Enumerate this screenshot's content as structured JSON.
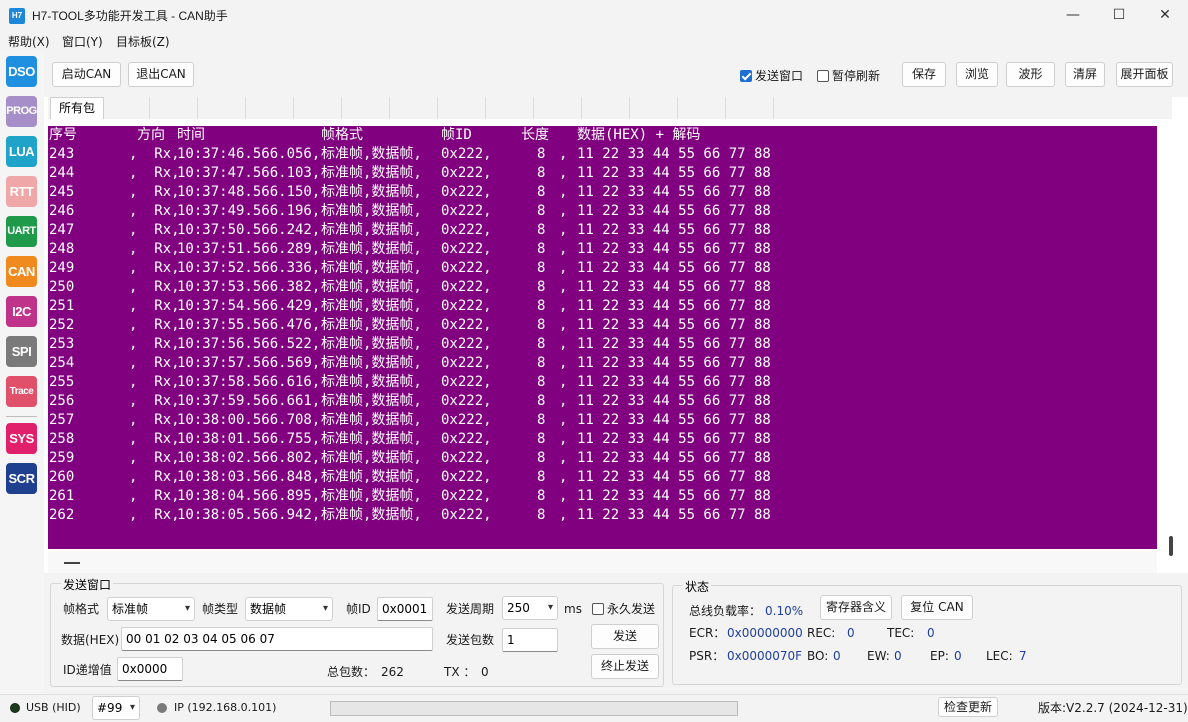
{
  "window": {
    "icon_text": "H7",
    "title": "H7-TOOL多功能开发工具 - CAN助手",
    "minimize": "—",
    "maximize": "☐",
    "close": "✕"
  },
  "menu": [
    "帮助(X)",
    "窗口(Y)",
    "目标板(Z)"
  ],
  "sidebar": [
    {
      "label": "DSO",
      "color": "#1f8fe0"
    },
    {
      "label": "PROG",
      "color": "#a68fc8"
    },
    {
      "label": "LUA",
      "color": "#1fa3c8"
    },
    {
      "label": "RTT",
      "color": "#f0a7a7"
    },
    {
      "label": "UART",
      "color": "#1f9a4a"
    },
    {
      "label": "CAN",
      "color": "#f08a1f"
    },
    {
      "label": "I2C",
      "color": "#c0338a"
    },
    {
      "label": "SPI",
      "color": "#7a7a7a"
    },
    {
      "label": "Trace",
      "color": "#e0506a"
    },
    {
      "label": "SYS",
      "color": "#e0206a"
    },
    {
      "label": "SCR",
      "color": "#1f3f8f"
    }
  ],
  "toolbar": {
    "start_can": "启动CAN",
    "exit_can": "退出CAN",
    "send_window_label": "发送窗口",
    "send_window_checked": true,
    "pause_refresh_label": "暂停刷新",
    "pause_refresh_checked": false,
    "save": "保存",
    "browse": "浏览",
    "waveform": "波形",
    "clear": "清屏",
    "expand_panel": "展开面板"
  },
  "tabs": [
    "所有包"
  ],
  "console": {
    "header": {
      "seq": "序号",
      "dir": "方向",
      "time": "时间",
      "fmt": "帧格式",
      "id": "帧ID",
      "len": "长度",
      "data": "数据(HEX) + 解码"
    },
    "rows": [
      {
        "seq": "243",
        "dir": ",  Rx,",
        "time": "10:37:46.566.056,",
        "fmt": "标准帧,数据帧,",
        "id": "0x222,",
        "len": "8",
        "sep": ",",
        "data": "11 22 33 44 55 66 77 88"
      },
      {
        "seq": "244",
        "dir": ",  Rx,",
        "time": "10:37:47.566.103,",
        "fmt": "标准帧,数据帧,",
        "id": "0x222,",
        "len": "8",
        "sep": ",",
        "data": "11 22 33 44 55 66 77 88"
      },
      {
        "seq": "245",
        "dir": ",  Rx,",
        "time": "10:37:48.566.150,",
        "fmt": "标准帧,数据帧,",
        "id": "0x222,",
        "len": "8",
        "sep": ",",
        "data": "11 22 33 44 55 66 77 88"
      },
      {
        "seq": "246",
        "dir": ",  Rx,",
        "time": "10:37:49.566.196,",
        "fmt": "标准帧,数据帧,",
        "id": "0x222,",
        "len": "8",
        "sep": ",",
        "data": "11 22 33 44 55 66 77 88"
      },
      {
        "seq": "247",
        "dir": ",  Rx,",
        "time": "10:37:50.566.242,",
        "fmt": "标准帧,数据帧,",
        "id": "0x222,",
        "len": "8",
        "sep": ",",
        "data": "11 22 33 44 55 66 77 88"
      },
      {
        "seq": "248",
        "dir": ",  Rx,",
        "time": "10:37:51.566.289,",
        "fmt": "标准帧,数据帧,",
        "id": "0x222,",
        "len": "8",
        "sep": ",",
        "data": "11 22 33 44 55 66 77 88"
      },
      {
        "seq": "249",
        "dir": ",  Rx,",
        "time": "10:37:52.566.336,",
        "fmt": "标准帧,数据帧,",
        "id": "0x222,",
        "len": "8",
        "sep": ",",
        "data": "11 22 33 44 55 66 77 88"
      },
      {
        "seq": "250",
        "dir": ",  Rx,",
        "time": "10:37:53.566.382,",
        "fmt": "标准帧,数据帧,",
        "id": "0x222,",
        "len": "8",
        "sep": ",",
        "data": "11 22 33 44 55 66 77 88"
      },
      {
        "seq": "251",
        "dir": ",  Rx,",
        "time": "10:37:54.566.429,",
        "fmt": "标准帧,数据帧,",
        "id": "0x222,",
        "len": "8",
        "sep": ",",
        "data": "11 22 33 44 55 66 77 88"
      },
      {
        "seq": "252",
        "dir": ",  Rx,",
        "time": "10:37:55.566.476,",
        "fmt": "标准帧,数据帧,",
        "id": "0x222,",
        "len": "8",
        "sep": ",",
        "data": "11 22 33 44 55 66 77 88"
      },
      {
        "seq": "253",
        "dir": ",  Rx,",
        "time": "10:37:56.566.522,",
        "fmt": "标准帧,数据帧,",
        "id": "0x222,",
        "len": "8",
        "sep": ",",
        "data": "11 22 33 44 55 66 77 88"
      },
      {
        "seq": "254",
        "dir": ",  Rx,",
        "time": "10:37:57.566.569,",
        "fmt": "标准帧,数据帧,",
        "id": "0x222,",
        "len": "8",
        "sep": ",",
        "data": "11 22 33 44 55 66 77 88"
      },
      {
        "seq": "255",
        "dir": ",  Rx,",
        "time": "10:37:58.566.616,",
        "fmt": "标准帧,数据帧,",
        "id": "0x222,",
        "len": "8",
        "sep": ",",
        "data": "11 22 33 44 55 66 77 88"
      },
      {
        "seq": "256",
        "dir": ",  Rx,",
        "time": "10:37:59.566.661,",
        "fmt": "标准帧,数据帧,",
        "id": "0x222,",
        "len": "8",
        "sep": ",",
        "data": "11 22 33 44 55 66 77 88"
      },
      {
        "seq": "257",
        "dir": ",  Rx,",
        "time": "10:38:00.566.708,",
        "fmt": "标准帧,数据帧,",
        "id": "0x222,",
        "len": "8",
        "sep": ",",
        "data": "11 22 33 44 55 66 77 88"
      },
      {
        "seq": "258",
        "dir": ",  Rx,",
        "time": "10:38:01.566.755,",
        "fmt": "标准帧,数据帧,",
        "id": "0x222,",
        "len": "8",
        "sep": ",",
        "data": "11 22 33 44 55 66 77 88"
      },
      {
        "seq": "259",
        "dir": ",  Rx,",
        "time": "10:38:02.566.802,",
        "fmt": "标准帧,数据帧,",
        "id": "0x222,",
        "len": "8",
        "sep": ",",
        "data": "11 22 33 44 55 66 77 88"
      },
      {
        "seq": "260",
        "dir": ",  Rx,",
        "time": "10:38:03.566.848,",
        "fmt": "标准帧,数据帧,",
        "id": "0x222,",
        "len": "8",
        "sep": ",",
        "data": "11 22 33 44 55 66 77 88"
      },
      {
        "seq": "261",
        "dir": ",  Rx,",
        "time": "10:38:04.566.895,",
        "fmt": "标准帧,数据帧,",
        "id": "0x222,",
        "len": "8",
        "sep": ",",
        "data": "11 22 33 44 55 66 77 88"
      },
      {
        "seq": "262",
        "dir": ",  Rx,",
        "time": "10:38:05.566.942,",
        "fmt": "标准帧,数据帧,",
        "id": "0x222,",
        "len": "8",
        "sep": ",",
        "data": "11 22 33 44 55 66 77 88"
      }
    ]
  },
  "send": {
    "group_title": "发送窗口",
    "frame_format_label": "帧格式",
    "frame_format_value": "标准帧",
    "frame_type_label": "帧类型",
    "frame_type_value": "数据帧",
    "frame_id_label": "帧ID",
    "frame_id_value": "0x0001",
    "period_label": "发送周期",
    "period_value": "250",
    "period_unit": "ms",
    "forever_label": "永久发送",
    "forever_checked": false,
    "data_label": "数据(HEX)",
    "data_value": "00 01 02 03 04 05 06 07",
    "count_label": "发送包数",
    "count_value": "1",
    "send_button": "发送",
    "id_inc_label": "ID递增值",
    "id_inc_value": "0x0000",
    "total_label": "总包数：",
    "total_value": "262",
    "tx_label": "TX ：",
    "tx_value": "0",
    "stop_button": "终止发送"
  },
  "status": {
    "group_title": "状态",
    "busload_label": "总线负载率：",
    "busload_value": "0.10%",
    "register_button": "寄存器含义",
    "reset_button": "复位 CAN",
    "ecr_label": "ECR：",
    "ecr_value": "0x00000000",
    "rec_label": "REC:",
    "rec_value": "0",
    "tec_label": "TEC:",
    "tec_value": "0",
    "psr_label": "PSR：",
    "psr_value": "0x0000070F",
    "bo_label": "BO:",
    "bo_value": "0",
    "ew_label": "EW:",
    "ew_value": "0",
    "ep_label": "EP:",
    "ep_value": "0",
    "lec_label": "LEC:",
    "lec_value": "7"
  },
  "statusbar": {
    "usb_label": "USB (HID)",
    "device_value": "#99",
    "ip_label": "IP (192.168.0.101)",
    "progress": 0,
    "check_update": "检查更新",
    "version": "版本:V2.2.7 (2024-12-31)"
  }
}
